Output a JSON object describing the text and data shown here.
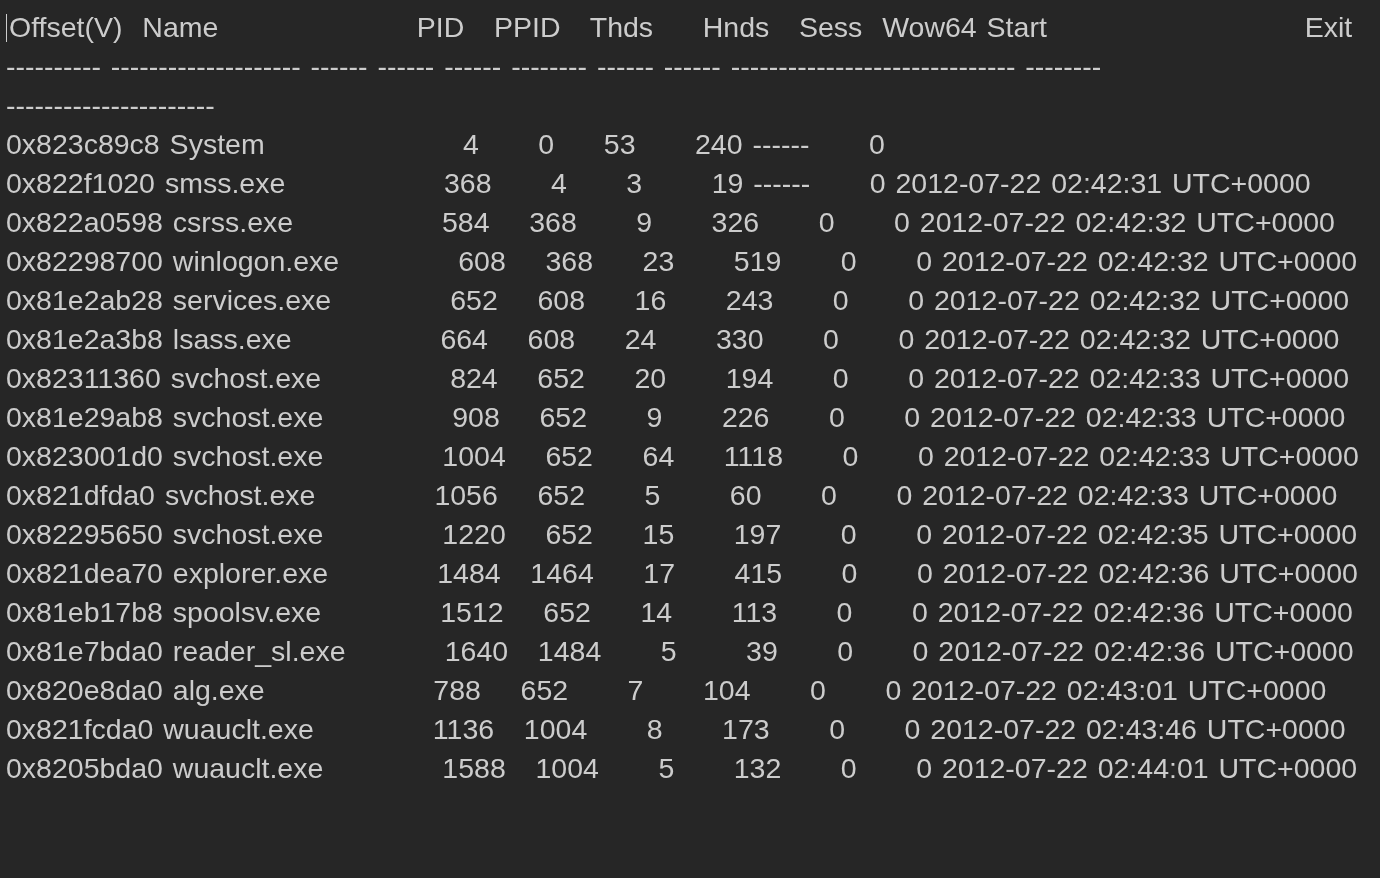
{
  "columns": [
    "Offset(V)",
    "Name",
    "PID",
    "PPID",
    "Thds",
    "Hnds",
    "Sess",
    "Wow64",
    "Start",
    "Exit"
  ],
  "separator": [
    "---------- -------------------- ------ ------ ------ -------- ------ ------ ------------------------------ --------",
    "----------------------"
  ],
  "rows": [
    {
      "offset": "0x823c89c8",
      "name": "System",
      "pid": "4",
      "ppid": "0",
      "thds": "53",
      "hnds": "240",
      "sess": "------",
      "wow64": "0"
    },
    {
      "offset": "0x822f1020",
      "name": "smss.exe",
      "pid": "368",
      "ppid": "4",
      "thds": "3",
      "hnds": "19",
      "sess": "------",
      "wow64": "0",
      "start": "2012-07-22 02:42:31 UTC+0000"
    },
    {
      "offset": "0x822a0598",
      "name": "csrss.exe",
      "pid": "584",
      "ppid": "368",
      "thds": "9",
      "hnds": "326",
      "sess": "0",
      "wow64": "0",
      "start": "2012-07-22 02:42:32 UTC+0000"
    },
    {
      "offset": "0x82298700",
      "name": "winlogon.exe",
      "pid": "608",
      "ppid": "368",
      "thds": "23",
      "hnds": "519",
      "sess": "0",
      "wow64": "0",
      "start": "2012-07-22 02:42:32 UTC+0000"
    },
    {
      "offset": "0x81e2ab28",
      "name": "services.exe",
      "pid": "652",
      "ppid": "608",
      "thds": "16",
      "hnds": "243",
      "sess": "0",
      "wow64": "0",
      "start": "2012-07-22 02:42:32 UTC+0000"
    },
    {
      "offset": "0x81e2a3b8",
      "name": "lsass.exe",
      "pid": "664",
      "ppid": "608",
      "thds": "24",
      "hnds": "330",
      "sess": "0",
      "wow64": "0",
      "start": "2012-07-22 02:42:32 UTC+0000"
    },
    {
      "offset": "0x82311360",
      "name": "svchost.exe",
      "pid": "824",
      "ppid": "652",
      "thds": "20",
      "hnds": "194",
      "sess": "0",
      "wow64": "0",
      "start": "2012-07-22 02:42:33 UTC+0000"
    },
    {
      "offset": "0x81e29ab8",
      "name": "svchost.exe",
      "pid": "908",
      "ppid": "652",
      "thds": "9",
      "hnds": "226",
      "sess": "0",
      "wow64": "0",
      "start": "2012-07-22 02:42:33 UTC+0000"
    },
    {
      "offset": "0x823001d0",
      "name": "svchost.exe",
      "pid": "1004",
      "ppid": "652",
      "thds": "64",
      "hnds": "1118",
      "sess": "0",
      "wow64": "0",
      "start": "2012-07-22 02:42:33 UTC+0000"
    },
    {
      "offset": "0x821dfda0",
      "name": "svchost.exe",
      "pid": "1056",
      "ppid": "652",
      "thds": "5",
      "hnds": "60",
      "sess": "0",
      "wow64": "0",
      "start": "2012-07-22 02:42:33 UTC+0000"
    },
    {
      "offset": "0x82295650",
      "name": "svchost.exe",
      "pid": "1220",
      "ppid": "652",
      "thds": "15",
      "hnds": "197",
      "sess": "0",
      "wow64": "0",
      "start": "2012-07-22 02:42:35 UTC+0000"
    },
    {
      "offset": "0x821dea70",
      "name": "explorer.exe",
      "pid": "1484",
      "ppid": "1464",
      "thds": "17",
      "hnds": "415",
      "sess": "0",
      "wow64": "0",
      "start": "2012-07-22 02:42:36 UTC+0000"
    },
    {
      "offset": "0x81eb17b8",
      "name": "spoolsv.exe",
      "pid": "1512",
      "ppid": "652",
      "thds": "14",
      "hnds": "113",
      "sess": "0",
      "wow64": "0",
      "start": "2012-07-22 02:42:36 UTC+0000"
    },
    {
      "offset": "0x81e7bda0",
      "name": "reader_sl.exe",
      "pid": "1640",
      "ppid": "1484",
      "thds": "5",
      "hnds": "39",
      "sess": "0",
      "wow64": "0",
      "start": "2012-07-22 02:42:36 UTC+0000"
    },
    {
      "offset": "0x820e8da0",
      "name": "alg.exe",
      "pid": "788",
      "ppid": "652",
      "thds": "7",
      "hnds": "104",
      "sess": "0",
      "wow64": "0",
      "start": "2012-07-22 02:43:01 UTC+0000"
    },
    {
      "offset": "0x821fcda0",
      "name": "wuauclt.exe",
      "pid": "1136",
      "ppid": "1004",
      "thds": "8",
      "hnds": "173",
      "sess": "0",
      "wow64": "0",
      "start": "2012-07-22 02:43:46 UTC+0000"
    },
    {
      "offset": "0x8205bda0",
      "name": "wuauclt.exe",
      "pid": "1588",
      "ppid": "1004",
      "thds": "5",
      "hnds": "132",
      "sess": "0",
      "wow64": "0",
      "start": "2012-07-22 02:44:01 UTC+0000"
    }
  ]
}
